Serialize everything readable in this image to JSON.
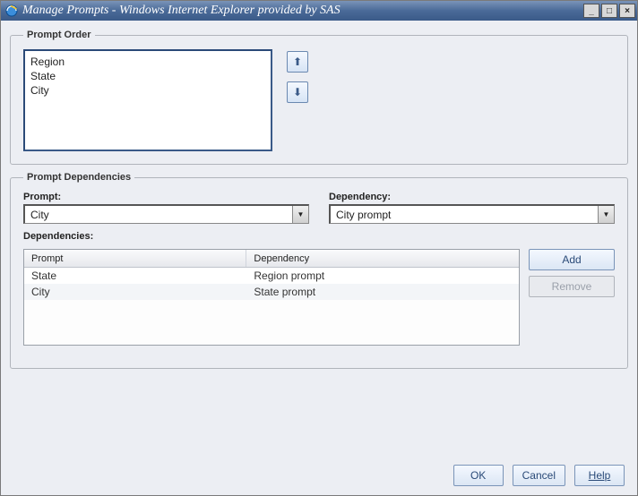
{
  "window": {
    "title": "Manage Prompts - Windows Internet Explorer provided by SAS"
  },
  "prompt_order": {
    "legend": "Prompt Order",
    "items": [
      "Region",
      "State",
      "City"
    ]
  },
  "prompt_dependencies": {
    "legend": "Prompt Dependencies",
    "prompt_label": "Prompt:",
    "prompt_value": "City",
    "dependency_label": "Dependency:",
    "dependency_value": "City prompt",
    "dependencies_label": "Dependencies:",
    "table": {
      "headers": {
        "prompt": "Prompt",
        "dependency": "Dependency"
      },
      "rows": [
        {
          "prompt": "State",
          "dependency": "Region prompt"
        },
        {
          "prompt": "City",
          "dependency": "State prompt"
        }
      ]
    },
    "buttons": {
      "add": "Add",
      "remove": "Remove"
    }
  },
  "footer": {
    "ok": "OK",
    "cancel": "Cancel",
    "help": "Help"
  }
}
